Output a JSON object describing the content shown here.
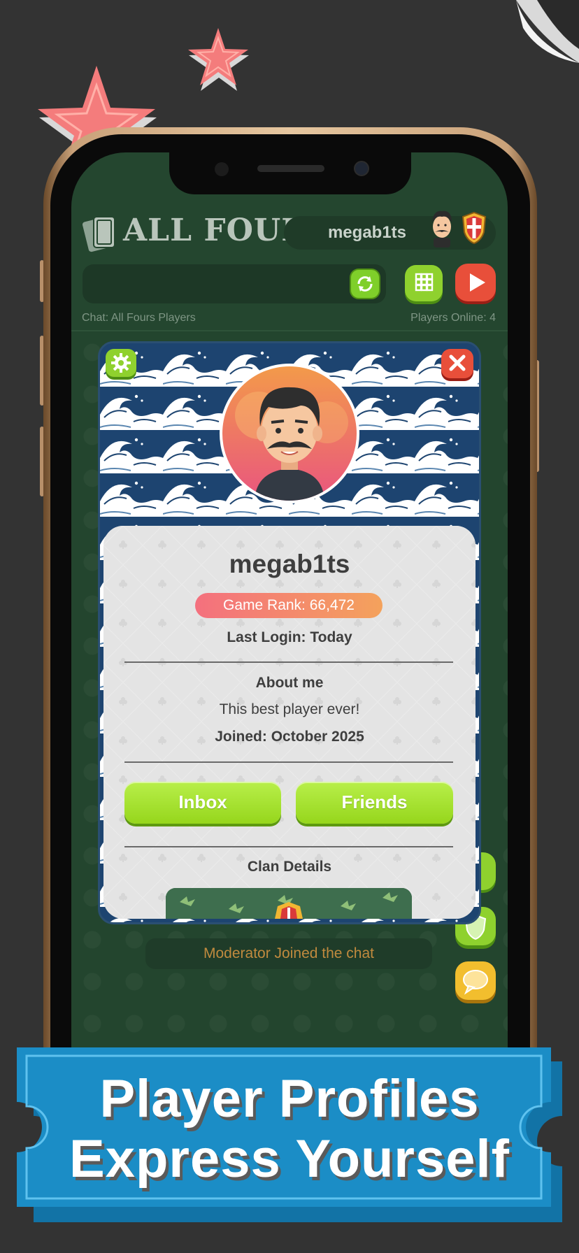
{
  "header": {
    "logo_text": "ALL FOURS",
    "username": "megab1ts"
  },
  "chat": {
    "label": "Chat: All Fours Players",
    "players_online": "Players Online: 4",
    "system_message": "Moderator Joined the chat"
  },
  "profile": {
    "name": "megab1ts",
    "rank": "Game Rank: 66,472",
    "last_login": "Last Login: Today",
    "about_title": "About me",
    "about_text": "This best player ever!",
    "joined": "Joined: October 2025",
    "inbox_label": "Inbox",
    "friends_label": "Friends",
    "clan_title": "Clan Details"
  },
  "banner": {
    "line1": "Player Profiles",
    "line2": "Express Yourself"
  },
  "icons": {
    "settings": "gear-icon",
    "close": "close-icon",
    "refresh": "refresh-icon",
    "grid": "grid-icon",
    "play": "play-icon",
    "shield": "shield-icon",
    "chat": "chat-bubble-icon"
  },
  "colors": {
    "background": "#333333",
    "table_green": "#24462f",
    "button_green": "#9fdc28",
    "close_red": "#e84f3a",
    "rank_gradient_start": "#f4707e",
    "rank_gradient_end": "#f4a25c",
    "banner_blue": "#1b8dc6",
    "star_pink": "#f47c7c"
  }
}
